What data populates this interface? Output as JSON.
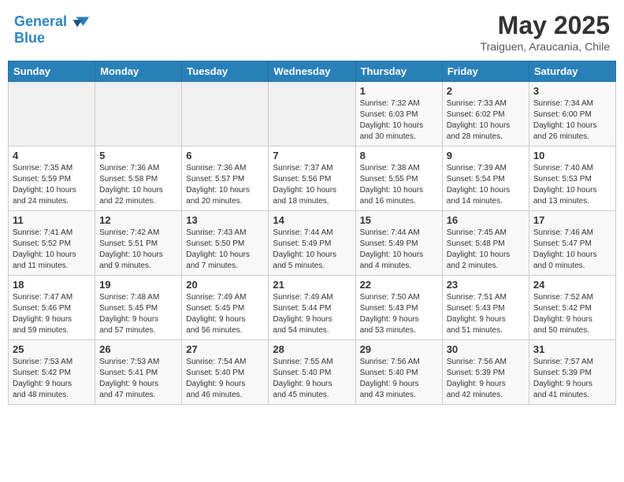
{
  "header": {
    "logo_line1": "General",
    "logo_line2": "Blue",
    "month": "May 2025",
    "location": "Traiguen, Araucania, Chile"
  },
  "weekdays": [
    "Sunday",
    "Monday",
    "Tuesday",
    "Wednesday",
    "Thursday",
    "Friday",
    "Saturday"
  ],
  "weeks": [
    [
      {
        "day": "",
        "info": ""
      },
      {
        "day": "",
        "info": ""
      },
      {
        "day": "",
        "info": ""
      },
      {
        "day": "",
        "info": ""
      },
      {
        "day": "1",
        "info": "Sunrise: 7:32 AM\nSunset: 6:03 PM\nDaylight: 10 hours\nand 30 minutes."
      },
      {
        "day": "2",
        "info": "Sunrise: 7:33 AM\nSunset: 6:02 PM\nDaylight: 10 hours\nand 28 minutes."
      },
      {
        "day": "3",
        "info": "Sunrise: 7:34 AM\nSunset: 6:00 PM\nDaylight: 10 hours\nand 26 minutes."
      }
    ],
    [
      {
        "day": "4",
        "info": "Sunrise: 7:35 AM\nSunset: 5:59 PM\nDaylight: 10 hours\nand 24 minutes."
      },
      {
        "day": "5",
        "info": "Sunrise: 7:36 AM\nSunset: 5:58 PM\nDaylight: 10 hours\nand 22 minutes."
      },
      {
        "day": "6",
        "info": "Sunrise: 7:36 AM\nSunset: 5:57 PM\nDaylight: 10 hours\nand 20 minutes."
      },
      {
        "day": "7",
        "info": "Sunrise: 7:37 AM\nSunset: 5:56 PM\nDaylight: 10 hours\nand 18 minutes."
      },
      {
        "day": "8",
        "info": "Sunrise: 7:38 AM\nSunset: 5:55 PM\nDaylight: 10 hours\nand 16 minutes."
      },
      {
        "day": "9",
        "info": "Sunrise: 7:39 AM\nSunset: 5:54 PM\nDaylight: 10 hours\nand 14 minutes."
      },
      {
        "day": "10",
        "info": "Sunrise: 7:40 AM\nSunset: 5:53 PM\nDaylight: 10 hours\nand 13 minutes."
      }
    ],
    [
      {
        "day": "11",
        "info": "Sunrise: 7:41 AM\nSunset: 5:52 PM\nDaylight: 10 hours\nand 11 minutes."
      },
      {
        "day": "12",
        "info": "Sunrise: 7:42 AM\nSunset: 5:51 PM\nDaylight: 10 hours\nand 9 minutes."
      },
      {
        "day": "13",
        "info": "Sunrise: 7:43 AM\nSunset: 5:50 PM\nDaylight: 10 hours\nand 7 minutes."
      },
      {
        "day": "14",
        "info": "Sunrise: 7:44 AM\nSunset: 5:49 PM\nDaylight: 10 hours\nand 5 minutes."
      },
      {
        "day": "15",
        "info": "Sunrise: 7:44 AM\nSunset: 5:49 PM\nDaylight: 10 hours\nand 4 minutes."
      },
      {
        "day": "16",
        "info": "Sunrise: 7:45 AM\nSunset: 5:48 PM\nDaylight: 10 hours\nand 2 minutes."
      },
      {
        "day": "17",
        "info": "Sunrise: 7:46 AM\nSunset: 5:47 PM\nDaylight: 10 hours\nand 0 minutes."
      }
    ],
    [
      {
        "day": "18",
        "info": "Sunrise: 7:47 AM\nSunset: 5:46 PM\nDaylight: 9 hours\nand 59 minutes."
      },
      {
        "day": "19",
        "info": "Sunrise: 7:48 AM\nSunset: 5:45 PM\nDaylight: 9 hours\nand 57 minutes."
      },
      {
        "day": "20",
        "info": "Sunrise: 7:49 AM\nSunset: 5:45 PM\nDaylight: 9 hours\nand 56 minutes."
      },
      {
        "day": "21",
        "info": "Sunrise: 7:49 AM\nSunset: 5:44 PM\nDaylight: 9 hours\nand 54 minutes."
      },
      {
        "day": "22",
        "info": "Sunrise: 7:50 AM\nSunset: 5:43 PM\nDaylight: 9 hours\nand 53 minutes."
      },
      {
        "day": "23",
        "info": "Sunrise: 7:51 AM\nSunset: 5:43 PM\nDaylight: 9 hours\nand 51 minutes."
      },
      {
        "day": "24",
        "info": "Sunrise: 7:52 AM\nSunset: 5:42 PM\nDaylight: 9 hours\nand 50 minutes."
      }
    ],
    [
      {
        "day": "25",
        "info": "Sunrise: 7:53 AM\nSunset: 5:42 PM\nDaylight: 9 hours\nand 48 minutes."
      },
      {
        "day": "26",
        "info": "Sunrise: 7:53 AM\nSunset: 5:41 PM\nDaylight: 9 hours\nand 47 minutes."
      },
      {
        "day": "27",
        "info": "Sunrise: 7:54 AM\nSunset: 5:40 PM\nDaylight: 9 hours\nand 46 minutes."
      },
      {
        "day": "28",
        "info": "Sunrise: 7:55 AM\nSunset: 5:40 PM\nDaylight: 9 hours\nand 45 minutes."
      },
      {
        "day": "29",
        "info": "Sunrise: 7:56 AM\nSunset: 5:40 PM\nDaylight: 9 hours\nand 43 minutes."
      },
      {
        "day": "30",
        "info": "Sunrise: 7:56 AM\nSunset: 5:39 PM\nDaylight: 9 hours\nand 42 minutes."
      },
      {
        "day": "31",
        "info": "Sunrise: 7:57 AM\nSunset: 5:39 PM\nDaylight: 9 hours\nand 41 minutes."
      }
    ]
  ]
}
